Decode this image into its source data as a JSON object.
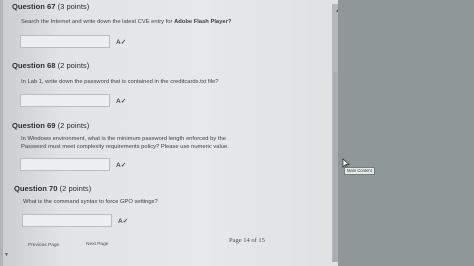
{
  "questions": [
    {
      "title": "Question 67",
      "points": "(3 points)",
      "text_before": "Search the Internet and write down the latest CVE entry for ",
      "text_bold": "Adobe Flash Player?",
      "answer": ""
    },
    {
      "title": "Question 68",
      "points": "(2 points)",
      "text": "In Lab 1, write down the password that is contained in the creditcards.txt file?",
      "answer": ""
    },
    {
      "title": "Question 69",
      "points": "(2 points)",
      "text_line1": "In Windows environment, what is the minimum password length enforced by the",
      "text_line2": "Password must meet complexity requirements policy? Please use numeric value.",
      "answer": ""
    },
    {
      "title": "Question 70",
      "points": "(2 points)",
      "text": "What is the command syntax to force GPO settings?",
      "answer": ""
    }
  ],
  "spell_check_icon": "spell-check-icon",
  "nav": {
    "previous": "Previous Page",
    "next": "Next Page",
    "page_indicator": "Page 14 of 15"
  },
  "tooltip": "Main Content"
}
